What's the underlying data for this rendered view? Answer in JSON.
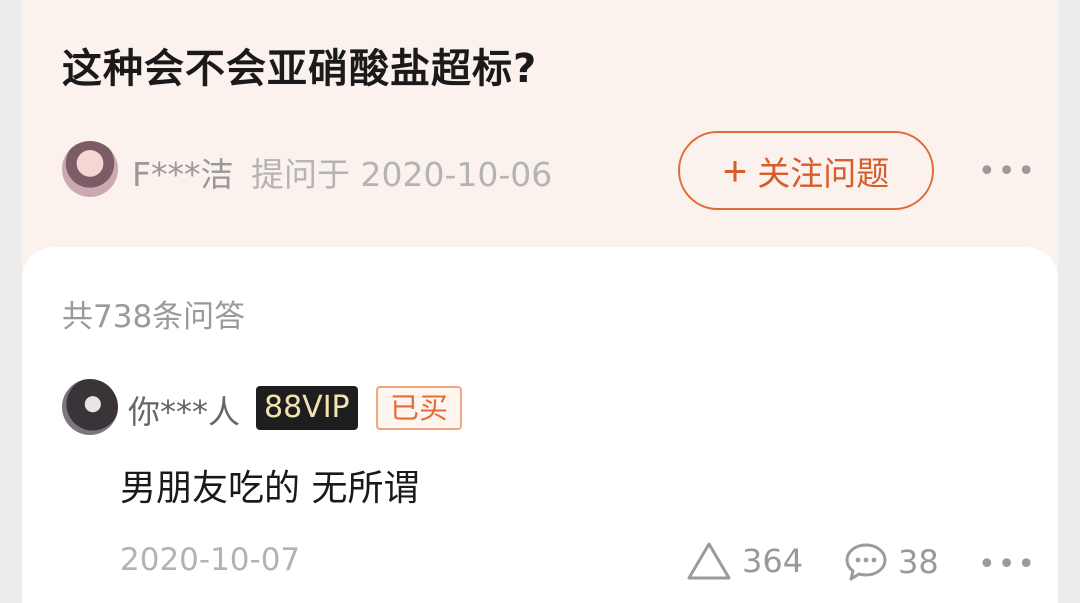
{
  "question": {
    "title": "这种会不会亚硝酸盐超标?",
    "asker_name": "F***洁",
    "asked_meta": "提问于 2020-10-06",
    "follow_button_label": "关注问题",
    "follow_icon": "plus-icon",
    "more_label": "•••"
  },
  "answers": {
    "count_label": "共738条问答",
    "items": [
      {
        "user_name": "你***人",
        "vip_badge": "88VIP",
        "bought_badge": "已买",
        "text": "男朋友吃的 无所谓",
        "date": "2020-10-07",
        "like_icon": "triangle-like-icon",
        "like_count": "364",
        "comment_icon": "comment-bubble-icon",
        "comment_count": "38",
        "more_label": "•••"
      }
    ]
  },
  "colors": {
    "accent": "#d65e2a",
    "top_background": "#fbf1ed",
    "vip_background": "#1e1e1e",
    "vip_text": "#f3e2b2"
  }
}
